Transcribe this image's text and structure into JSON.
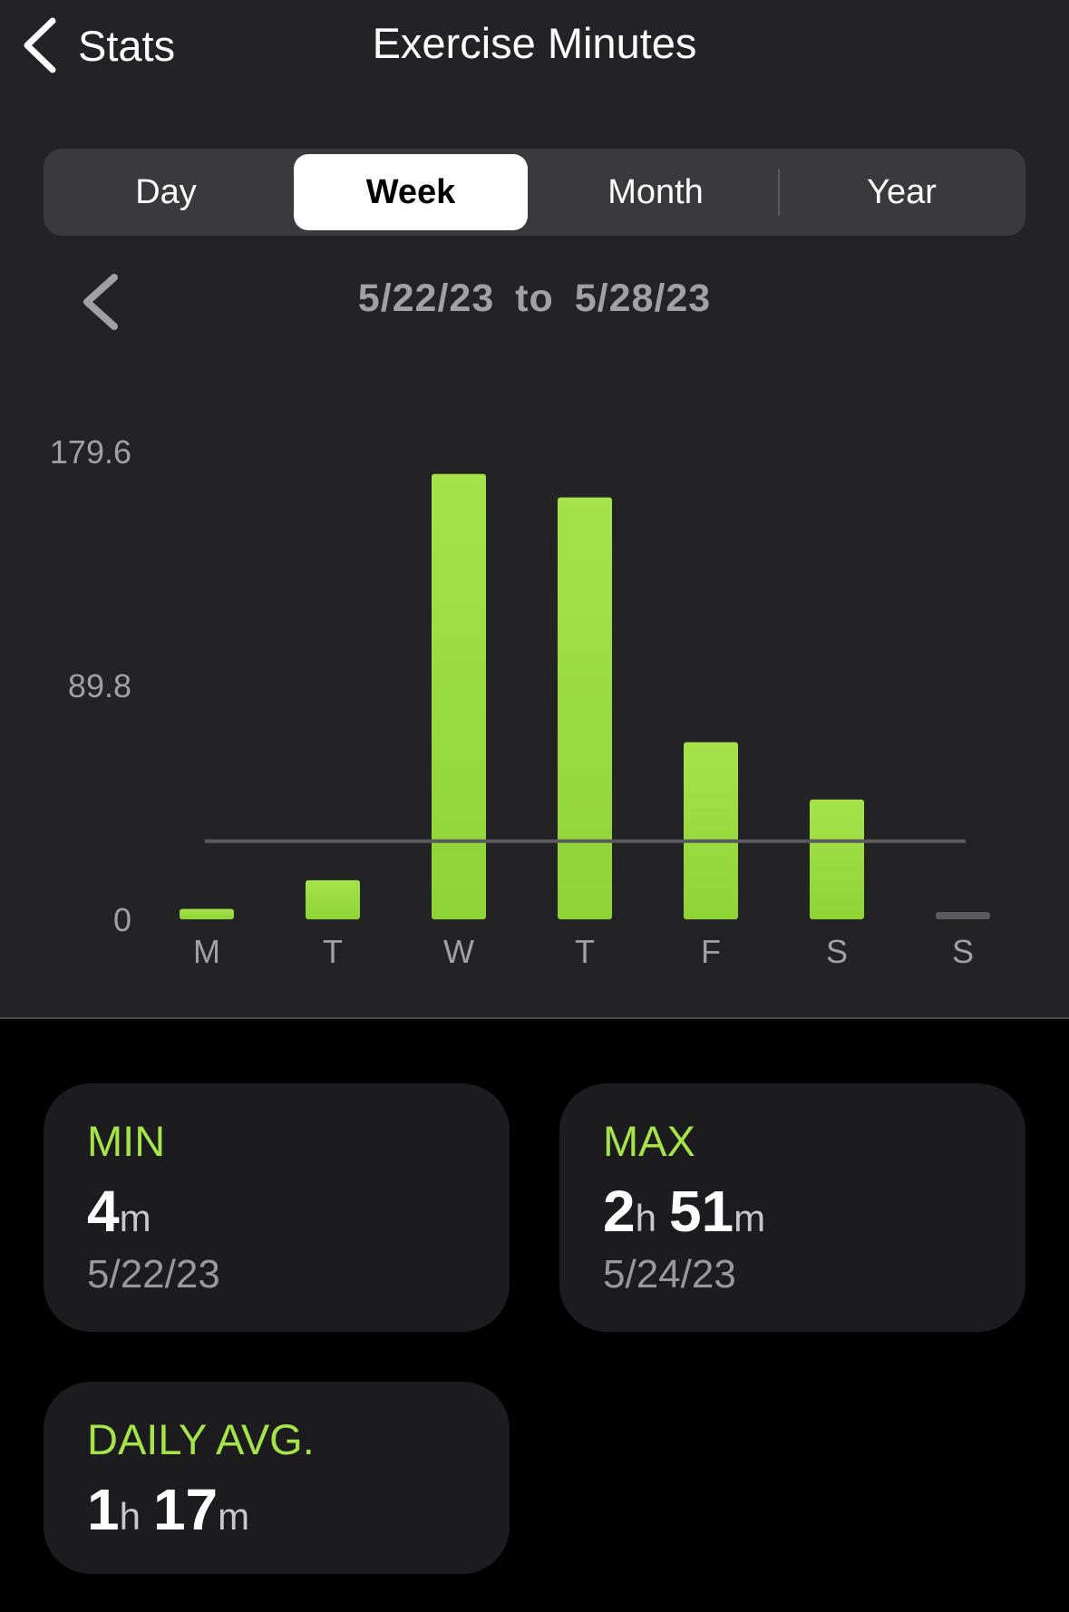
{
  "nav": {
    "back_label": "Stats",
    "title": "Exercise Minutes"
  },
  "segments": {
    "items": [
      "Day",
      "Week",
      "Month",
      "Year"
    ],
    "selected": "Week"
  },
  "range": {
    "start": "5/22/23",
    "joiner": "to",
    "end": "5/28/23"
  },
  "chart_data": {
    "type": "bar",
    "categories": [
      "M",
      "T",
      "W",
      "T",
      "F",
      "S",
      "S"
    ],
    "values": [
      4,
      15,
      171,
      162,
      68,
      46,
      0
    ],
    "ylim": [
      0,
      179.6
    ],
    "yticks": [
      "179.6",
      "89.8",
      "0"
    ],
    "reference_line": 30,
    "bar_color": "#a6e34b",
    "zero_bar_color": "#5a5a5e",
    "grid": false,
    "title": "",
    "xlabel": "",
    "ylabel": ""
  },
  "stats": {
    "min": {
      "label": "MIN",
      "minutes": "4",
      "m_unit": "m",
      "date": "5/22/23"
    },
    "max": {
      "label": "MAX",
      "hours": "2",
      "h_unit": "h",
      "minutes": "51",
      "m_unit": "m",
      "date": "5/24/23"
    },
    "avg": {
      "label": "DAILY AVG.",
      "hours": "1",
      "h_unit": "h",
      "minutes": "17",
      "m_unit": "m"
    }
  },
  "colors": {
    "accent": "#a6e34b",
    "panel": "#232325",
    "card": "#1c1c1e"
  }
}
